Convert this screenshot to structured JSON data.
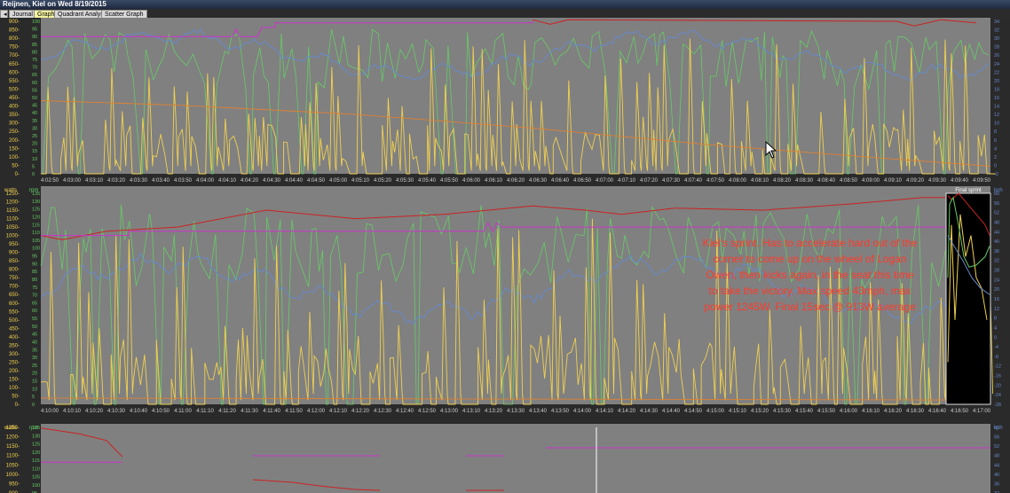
{
  "window": {
    "title": "Reijnen, Kiel on Wed 8/19/2015"
  },
  "tabs": [
    {
      "label": "Journal",
      "active": false
    },
    {
      "label": "Graph",
      "active": true
    },
    {
      "label": "Quadrant Analysis",
      "active": false
    },
    {
      "label": "Scatter Graph",
      "active": false
    }
  ],
  "colors": {
    "power": "#f0d050",
    "cadence": "#66cc66",
    "speed": "#cc2222",
    "hr": "#6688cc",
    "grade": "#cc33cc",
    "elevation": "#e08030"
  },
  "panels": [
    {
      "id": "top",
      "header": {
        "left": "",
        "rpm": "",
        "kph": ""
      },
      "watts_axis": [
        "900-",
        "850-",
        "800-",
        "750-",
        "700-",
        "650-",
        "600-",
        "550-",
        "500-",
        "450-",
        "400-",
        "350-",
        "300-",
        "250-",
        "200-",
        "150-",
        "100-",
        "50-",
        "0-"
      ],
      "rpm_axis": [
        "100",
        "95",
        "90",
        "85",
        "80",
        "75",
        "70",
        "65",
        "60",
        "55",
        "50",
        "45",
        "40",
        "35",
        "30",
        "25",
        "20",
        "15",
        "10",
        "5",
        "0"
      ],
      "right_axis": [
        "34",
        "32",
        "30",
        "28",
        "26",
        "24",
        "22",
        "20",
        "18",
        "16",
        "14",
        "12",
        "10",
        "8",
        "6",
        "4",
        "2",
        "0",
        "-2"
      ],
      "time_axis": [
        "4:02:50",
        "4:03:00",
        "4:03:10",
        "4:03:20",
        "4:03:30",
        "4:03:40",
        "4:03:50",
        "4:04:00",
        "4:04:10",
        "4:04:20",
        "4:04:30",
        "4:04:40",
        "4:04:50",
        "4:05:00",
        "4:05:10",
        "4:05:20",
        "4:05:30",
        "4:05:40",
        "4:05:50",
        "4:06:00",
        "4:06:10",
        "4:06:20",
        "4:06:30",
        "4:06:40",
        "4:06:50",
        "4:07:00",
        "4:07:10",
        "4:07:20",
        "4:07:30",
        "4:07:40",
        "4:07:50",
        "4:08:00",
        "4:08:10",
        "4:08:20",
        "4:08:30",
        "4:08:40",
        "4:08:50",
        "4:09:00",
        "4:09:10",
        "4:09:20",
        "4:09:30",
        "4:09:40",
        "4:09:50"
      ]
    },
    {
      "id": "middle",
      "header": {
        "left": "watts",
        "rpm": "rpm",
        "kph": "kph"
      },
      "watts_axis": [
        "1250-",
        "1200-",
        "1150-",
        "1100-",
        "1050-",
        "1000-",
        "950-",
        "900-",
        "850-",
        "800-",
        "750-",
        "700-",
        "650-",
        "600-",
        "550-",
        "500-",
        "450-",
        "400-",
        "350-",
        "300-",
        "250-",
        "200-",
        "150-",
        "100-",
        "50-",
        "0-"
      ],
      "rpm_axis": [
        "135",
        "130",
        "125",
        "120",
        "115",
        "110",
        "105",
        "100",
        "95",
        "90",
        "85",
        "80",
        "75",
        "70",
        "65",
        "60",
        "55",
        "50",
        "45",
        "40",
        "35",
        "30",
        "25",
        "20",
        "15",
        "10",
        "5",
        "0"
      ],
      "right_axis": [
        "60",
        "56",
        "52",
        "48",
        "44",
        "40",
        "36",
        "32",
        "28",
        "24",
        "20",
        "16",
        "12",
        "8",
        "4",
        "0",
        "-4",
        "-8",
        "-12",
        "-16",
        "-20",
        "-24",
        "-28"
      ],
      "time_axis": [
        "4:10:00",
        "4:10:10",
        "4:10:20",
        "4:10:30",
        "4:10:40",
        "4:10:50",
        "4:11:00",
        "4:11:10",
        "4:11:20",
        "4:11:30",
        "4:11:40",
        "4:11:50",
        "4:12:00",
        "4:12:10",
        "4:12:20",
        "4:12:30",
        "4:12:40",
        "4:12:50",
        "4:13:00",
        "4:13:10",
        "4:13:20",
        "4:13:30",
        "4:13:40",
        "4:13:50",
        "4:14:00",
        "4:14:10",
        "4:14:20",
        "4:14:30",
        "4:14:40",
        "4:14:50",
        "4:15:00",
        "4:15:10",
        "4:15:20",
        "4:15:30",
        "4:15:40",
        "4:15:50",
        "4:16:00",
        "4:16:10",
        "4:16:20",
        "4:16:30",
        "4:16:40",
        "4:16:50",
        "4:17:00"
      ],
      "box_label": "Final sprint",
      "annotation": "Kiel's sprint. Has to accelerate hard out of the corner to come up on the wheel of Logan Owen, then kicks again, in the seat this time to take the victory. Max speed 43mph, max power 1245W. Final 15sec @ 913W average"
    },
    {
      "id": "bottom",
      "header": {
        "left": "watts",
        "rpm": "rpm",
        "kph": "kph"
      },
      "watts_axis": [
        "1250-",
        "1200-",
        "1150-",
        "1100-",
        "1050-",
        "1000-",
        "950-",
        "900-"
      ],
      "rpm_axis": [
        "135",
        "130",
        "125",
        "120",
        "115",
        "110",
        "105",
        "100",
        "95"
      ],
      "right_axis": [
        "60",
        "56",
        "52",
        "48",
        "44",
        "40",
        "36",
        "32"
      ],
      "time_axis": []
    }
  ]
}
